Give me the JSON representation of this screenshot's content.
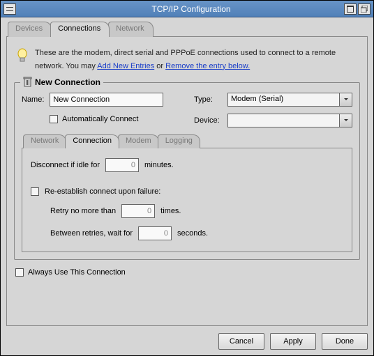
{
  "window": {
    "title": "TCP/IP Configuration"
  },
  "tabs": {
    "devices": "Devices",
    "connections": "Connections",
    "network": "Network"
  },
  "info": {
    "prefix": "These are the modem, direct serial and PPPoE connections used to connect to a remote network. You may  ",
    "add_link": "Add New Entries",
    "mid": "  or  ",
    "remove_link": "Remove the entry below."
  },
  "group": {
    "title": "New Connection",
    "name_label": "Name:",
    "name_value": "New Connection",
    "auto_label": "Automatically Connect",
    "type_label": "Type:",
    "type_value": "Modem (Serial)",
    "device_label": "Device:",
    "device_value": ""
  },
  "inner_tabs": {
    "network": "Network",
    "connection": "Connection",
    "modem": "Modem",
    "logging": "Logging"
  },
  "conn": {
    "idle_prefix": "Disconnect if idle for",
    "idle_value": "0",
    "idle_suffix": "minutes.",
    "reestablish_label": "Re-establish connect upon failure:",
    "retry_prefix": "Retry no more than",
    "retry_value": "0",
    "retry_suffix": "times.",
    "wait_prefix": "Between retries, wait for",
    "wait_value": "0",
    "wait_suffix": "seconds."
  },
  "always_label": "Always Use This Connection",
  "buttons": {
    "cancel": "Cancel",
    "apply": "Apply",
    "done": "Done"
  }
}
